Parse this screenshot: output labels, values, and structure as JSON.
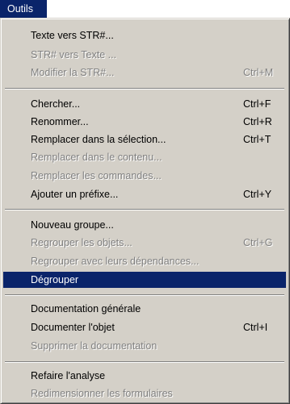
{
  "menu": {
    "title": "Outils",
    "items": [
      {
        "label": "Texte vers STR#...",
        "shortcut": "",
        "disabled": false
      },
      {
        "label": "STR# vers Texte ...",
        "shortcut": "",
        "disabled": true
      },
      {
        "label": "Modifier la STR#...",
        "shortcut": "Ctrl+M",
        "disabled": true
      },
      {
        "label": "Chercher...",
        "shortcut": "Ctrl+F",
        "disabled": false
      },
      {
        "label": "Renommer...",
        "shortcut": "Ctrl+R",
        "disabled": false
      },
      {
        "label": "Remplacer dans la sélection...",
        "shortcut": "Ctrl+T",
        "disabled": false
      },
      {
        "label": "Remplacer dans le contenu...",
        "shortcut": "",
        "disabled": true
      },
      {
        "label": "Remplacer les commandes...",
        "shortcut": "",
        "disabled": true
      },
      {
        "label": "Ajouter un préfixe...",
        "shortcut": "Ctrl+Y",
        "disabled": false
      },
      {
        "label": "Nouveau groupe...",
        "shortcut": "",
        "disabled": false
      },
      {
        "label": "Regrouper les objets...",
        "shortcut": "Ctrl+G",
        "disabled": true
      },
      {
        "label": "Regrouper avec leurs dépendances...",
        "shortcut": "",
        "disabled": true
      },
      {
        "label": "Dégrouper",
        "shortcut": "",
        "disabled": false,
        "highlighted": true
      },
      {
        "label": "Documentation générale",
        "shortcut": "",
        "disabled": false
      },
      {
        "label": "Documenter l'objet",
        "shortcut": "Ctrl+I",
        "disabled": false
      },
      {
        "label": "Supprimer la documentation",
        "shortcut": "",
        "disabled": true
      },
      {
        "label": "Refaire l'analyse",
        "shortcut": "",
        "disabled": false
      },
      {
        "label": "Redimensionner les formulaires",
        "shortcut": "",
        "disabled": true
      }
    ]
  },
  "colors": {
    "menu_background": "#d4d0c8",
    "highlight": "#0a246a",
    "disabled_text": "#808080"
  }
}
